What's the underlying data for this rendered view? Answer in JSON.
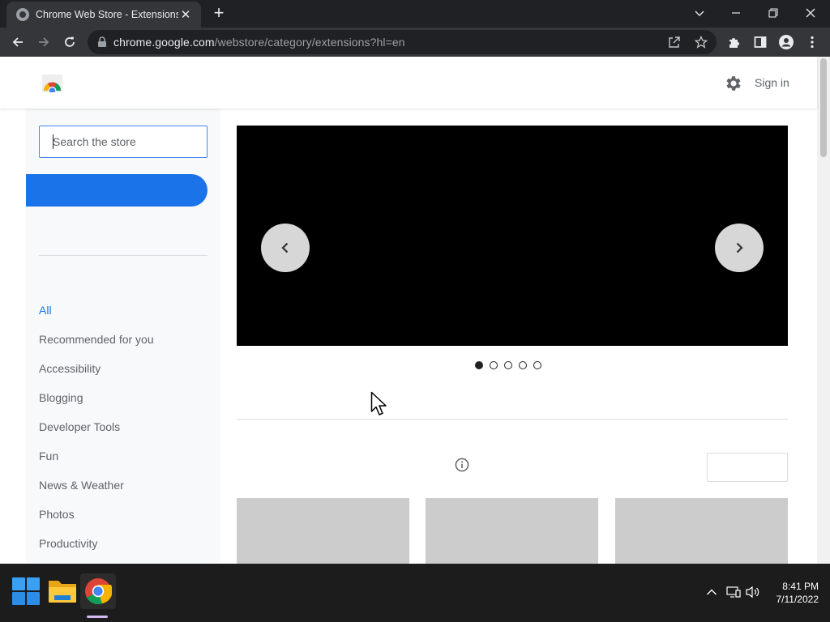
{
  "browser": {
    "tab_title": "Chrome Web Store - Extensions",
    "new_tab_label": "+",
    "url": {
      "host": "chrome.google.com",
      "path": "/webstore/category/extensions?hl=en"
    }
  },
  "header": {
    "sign_in": "Sign in"
  },
  "sidebar": {
    "search_placeholder": "Search the store",
    "categories": [
      {
        "label": "All"
      },
      {
        "label": "Recommended for you"
      },
      {
        "label": "Accessibility"
      },
      {
        "label": "Blogging"
      },
      {
        "label": "Developer Tools"
      },
      {
        "label": "Fun"
      },
      {
        "label": "News & Weather"
      },
      {
        "label": "Photos"
      },
      {
        "label": "Productivity"
      }
    ]
  },
  "carousel": {
    "total_slides": 5,
    "active_slide": 1
  },
  "taskbar": {
    "time": "8:41 PM",
    "date": "7/11/2022"
  },
  "colors": {
    "accent": "#1a73e8",
    "chrome_dark": "#202124",
    "chrome_toolbar": "#35363a",
    "sidebar_bg": "#f8f9fa",
    "card_placeholder": "#cccccc"
  }
}
